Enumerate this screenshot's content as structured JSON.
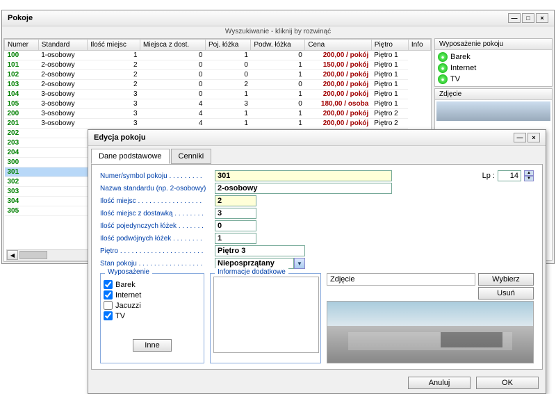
{
  "mainWindow": {
    "title": "Pokoje",
    "searchHint": "Wyszukiwanie - kliknij by rozwinąć",
    "columns": [
      "Numer",
      "Standard",
      "Ilość miejsc",
      "Miejsca z dost.",
      "Poj. łóżka",
      "Podw. łóżka",
      "Cena",
      "Piętro",
      "Info"
    ],
    "rows": [
      {
        "num": "100",
        "std": "1-osobowy",
        "miejsc": "1",
        "zdost": "0",
        "poj": "1",
        "podw": "0",
        "cena": "200,00 / pokój",
        "pietro": "Piętro 1"
      },
      {
        "num": "101",
        "std": "2-osobowy",
        "miejsc": "2",
        "zdost": "0",
        "poj": "0",
        "podw": "1",
        "cena": "150,00 / pokój",
        "pietro": "Piętro 1"
      },
      {
        "num": "102",
        "std": "2-osobowy",
        "miejsc": "2",
        "zdost": "0",
        "poj": "0",
        "podw": "1",
        "cena": "200,00 / pokój",
        "pietro": "Piętro 1"
      },
      {
        "num": "103",
        "std": "2-osobowy",
        "miejsc": "2",
        "zdost": "0",
        "poj": "2",
        "podw": "0",
        "cena": "200,00 / pokój",
        "pietro": "Piętro 1"
      },
      {
        "num": "104",
        "std": "3-osobowy",
        "miejsc": "3",
        "zdost": "0",
        "poj": "1",
        "podw": "1",
        "cena": "200,00 / pokój",
        "pietro": "Piętro 1"
      },
      {
        "num": "105",
        "std": "3-osobowy",
        "miejsc": "3",
        "zdost": "4",
        "poj": "3",
        "podw": "0",
        "cena": "180,00 / osoba",
        "pietro": "Piętro 1"
      },
      {
        "num": "200",
        "std": "3-osobowy",
        "miejsc": "3",
        "zdost": "4",
        "poj": "1",
        "podw": "1",
        "cena": "200,00 / pokój",
        "pietro": "Piętro 2"
      },
      {
        "num": "201",
        "std": "3-osobowy",
        "miejsc": "3",
        "zdost": "4",
        "poj": "1",
        "podw": "1",
        "cena": "200,00 / pokój",
        "pietro": "Piętro 2"
      },
      {
        "num": "202",
        "std": "",
        "miejsc": "",
        "zdost": "",
        "poj": "",
        "podw": "",
        "cena": "",
        "pietro": ""
      },
      {
        "num": "203",
        "std": "",
        "miejsc": "",
        "zdost": "",
        "poj": "",
        "podw": "",
        "cena": "",
        "pietro": ""
      },
      {
        "num": "204",
        "std": "",
        "miejsc": "",
        "zdost": "",
        "poj": "",
        "podw": "",
        "cena": "",
        "pietro": ""
      },
      {
        "num": "300",
        "std": "",
        "miejsc": "",
        "zdost": "",
        "poj": "",
        "podw": "",
        "cena": "",
        "pietro": ""
      },
      {
        "num": "301",
        "std": "",
        "miejsc": "",
        "zdost": "",
        "poj": "",
        "podw": "",
        "cena": "",
        "pietro": "",
        "selected": true
      },
      {
        "num": "302",
        "std": "",
        "miejsc": "",
        "zdost": "",
        "poj": "",
        "podw": "",
        "cena": "",
        "pietro": ""
      },
      {
        "num": "303",
        "std": "",
        "miejsc": "",
        "zdost": "",
        "poj": "",
        "podw": "",
        "cena": "",
        "pietro": ""
      },
      {
        "num": "304",
        "std": "",
        "miejsc": "",
        "zdost": "",
        "poj": "",
        "podw": "",
        "cena": "",
        "pietro": ""
      },
      {
        "num": "305",
        "std": "",
        "miejsc": "",
        "zdost": "",
        "poj": "",
        "podw": "",
        "cena": "",
        "pietro": ""
      }
    ],
    "featuresTitle": "Wyposażenie pokoju",
    "features": [
      "Barek",
      "Internet",
      "TV"
    ],
    "photoTitle": "Zdjęcie"
  },
  "dialog": {
    "title": "Edycja pokoju",
    "tabs": [
      "Dane podstawowe",
      "Cenniki"
    ],
    "labels": {
      "numer": "Numer/symbol pokoju . . . . . . . . .",
      "nazwa": "Nazwa standardu (np. 2-osobowy)",
      "miejsc": "Ilość miejsc . . . . . . . . . . . . . . . . .",
      "zdost": "Ilość miejsc z dostawką . . . . . . . .",
      "poj": "Ilość pojedynczych łóżek . . . . . . .",
      "podw": "Ilość podwójnych łóżek . . . . . . . .",
      "pietro": "Piętro . . . . . . . . . . . . . . . . . . . . . .",
      "stan": "Stan pokoju . . . . . . . . . . . . . . . . ."
    },
    "values": {
      "numer": "301",
      "nazwa": "2-osobowy",
      "miejsc": "2",
      "zdost": "3",
      "poj": "0",
      "podw": "1",
      "pietro": "Piętro 3",
      "stan": "Nieposprzątany",
      "lpLabel": "Lp :",
      "lp": "14"
    },
    "equipTitle": "Wyposażenie",
    "equipItems": [
      {
        "label": "Barek",
        "checked": true
      },
      {
        "label": "Internet",
        "checked": true
      },
      {
        "label": "Jacuzzi",
        "checked": false
      },
      {
        "label": "TV",
        "checked": true
      }
    ],
    "inneBtn": "Inne",
    "infoTitle": "Informacje dodatkowe",
    "photoTitle": "Zdjęcie",
    "wybierzBtn": "Wybierz",
    "usunBtn": "Usuń",
    "anulujBtn": "Anuluj",
    "okBtn": "OK"
  }
}
